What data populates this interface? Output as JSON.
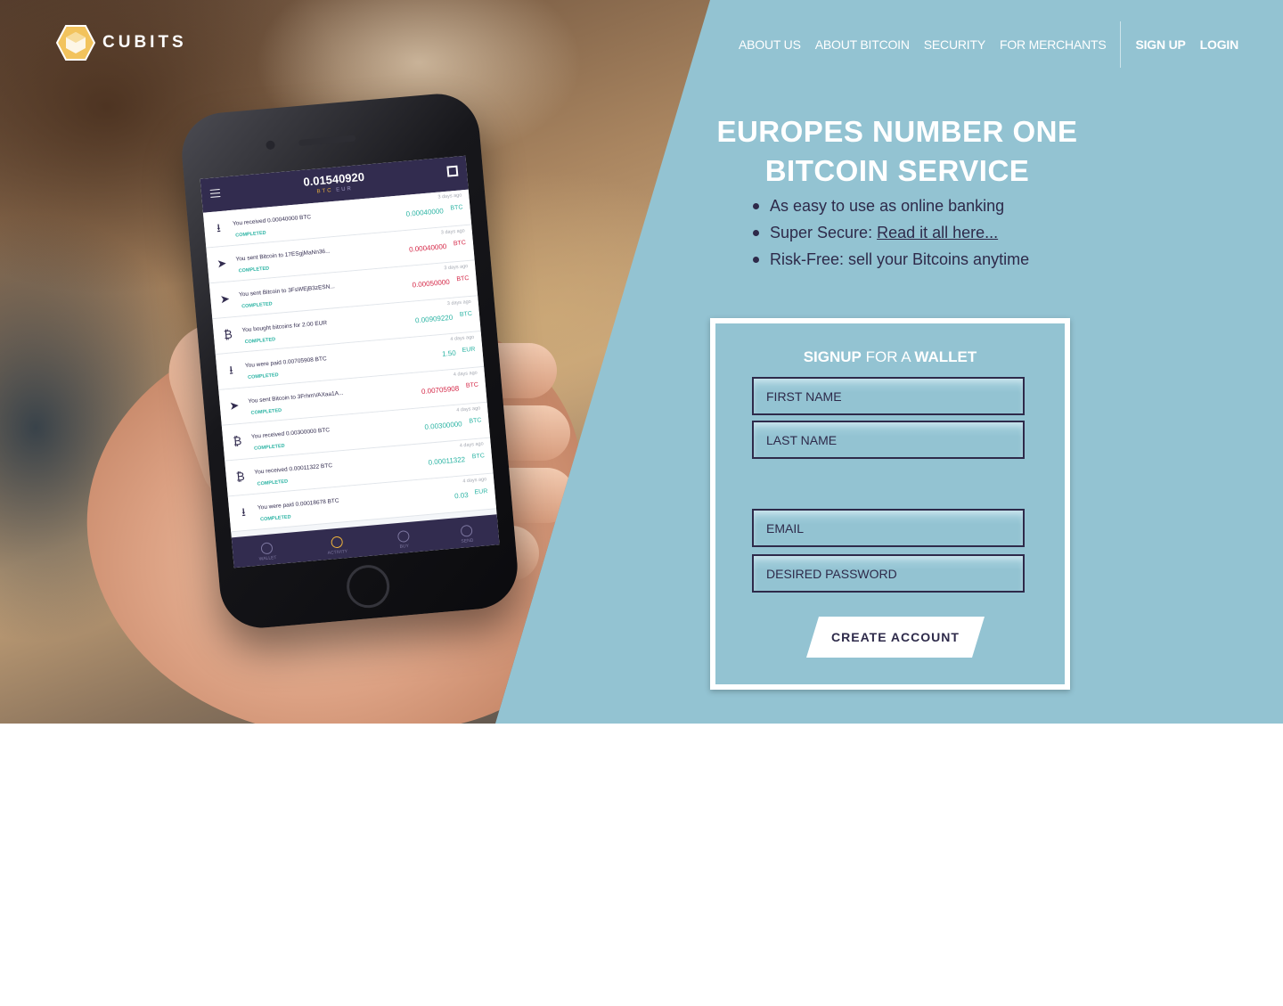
{
  "brand": {
    "name": "CUBITS",
    "colors": {
      "accent": "#93c3d2",
      "dark": "#2e2a4a",
      "logo": "#f2c35d"
    }
  },
  "nav": {
    "links": [
      "ABOUT US",
      "ABOUT BITCOIN",
      "SECURITY",
      "FOR MERCHANTS"
    ],
    "signup": "SIGN UP",
    "login": "LOGIN"
  },
  "hero": {
    "headline": [
      "EUROPES NUMBER ONE",
      "BITCOIN SERVICE"
    ],
    "bullets": [
      {
        "text": "As easy to use as online banking"
      },
      {
        "text": "Super Secure: ",
        "link": "Read it all here..."
      },
      {
        "text": "Risk-Free: sell your Bitcoins anytime"
      }
    ]
  },
  "signup": {
    "title": {
      "signup": "SIGNUP",
      "for": " FOR A ",
      "wallet": "WALLET"
    },
    "fields": {
      "first_name": {
        "placeholder": "FIRST NAME",
        "value": ""
      },
      "last_name": {
        "placeholder": "LAST NAME",
        "value": ""
      },
      "email": {
        "placeholder": "EMAIL",
        "value": ""
      },
      "password": {
        "placeholder": "DESIRED PASSWORD",
        "value": ""
      }
    },
    "submit": "CREATE ACCOUNT"
  },
  "phone": {
    "balance": "0.01540920",
    "units": [
      "BTC",
      "EUR"
    ],
    "transactions": [
      {
        "icon": "download-icon",
        "desc": "You received 0.00040000 BTC",
        "status": "COMPLETED",
        "ago": "3 days ago",
        "amount": "0.00040000",
        "currency": "BTC",
        "type": "pos"
      },
      {
        "icon": "send-icon",
        "desc": "You sent Bitcoin to 17ESgjMaNn36...",
        "status": "COMPLETED",
        "ago": "3 days ago",
        "amount": "0.00040000",
        "currency": "BTC",
        "type": "neg"
      },
      {
        "icon": "send-icon",
        "desc": "You sent Bitcoin to 3FsWEjB3zESN...",
        "status": "COMPLETED",
        "ago": "3 days ago",
        "amount": "0.00050000",
        "currency": "BTC",
        "type": "neg"
      },
      {
        "icon": "bitcoin-icon",
        "desc": "You bought bitcoins for 2.00 EUR",
        "status": "COMPLETED",
        "ago": "3 days ago",
        "amount": "0.00909220",
        "currency": "BTC",
        "type": "pos"
      },
      {
        "icon": "download-icon",
        "desc": "You were paid 0.00705908 BTC",
        "status": "COMPLETED",
        "ago": "4 days ago",
        "amount": "1.50",
        "currency": "EUR",
        "type": "pos"
      },
      {
        "icon": "send-icon",
        "desc": "You sent Bitcoin to 3FrhmVAXaa1A...",
        "status": "COMPLETED",
        "ago": "4 days ago",
        "amount": "0.00705908",
        "currency": "BTC",
        "type": "neg"
      },
      {
        "icon": "bitcoin-icon",
        "desc": "You received 0.00300000 BTC",
        "status": "COMPLETED",
        "ago": "4 days ago",
        "amount": "0.00300000",
        "currency": "BTC",
        "type": "pos"
      },
      {
        "icon": "bitcoin-icon",
        "desc": "You received 0.00011322 BTC",
        "status": "COMPLETED",
        "ago": "4 days ago",
        "amount": "0.00011322",
        "currency": "BTC",
        "type": "pos"
      },
      {
        "icon": "download-icon",
        "desc": "You were paid 0.00018678 BTC",
        "status": "COMPLETED",
        "ago": "4 days ago",
        "amount": "0.03",
        "currency": "EUR",
        "type": "pos"
      }
    ],
    "tabs": [
      "WALLET",
      "ACTIVITY",
      "BUY",
      "SEND"
    ]
  }
}
